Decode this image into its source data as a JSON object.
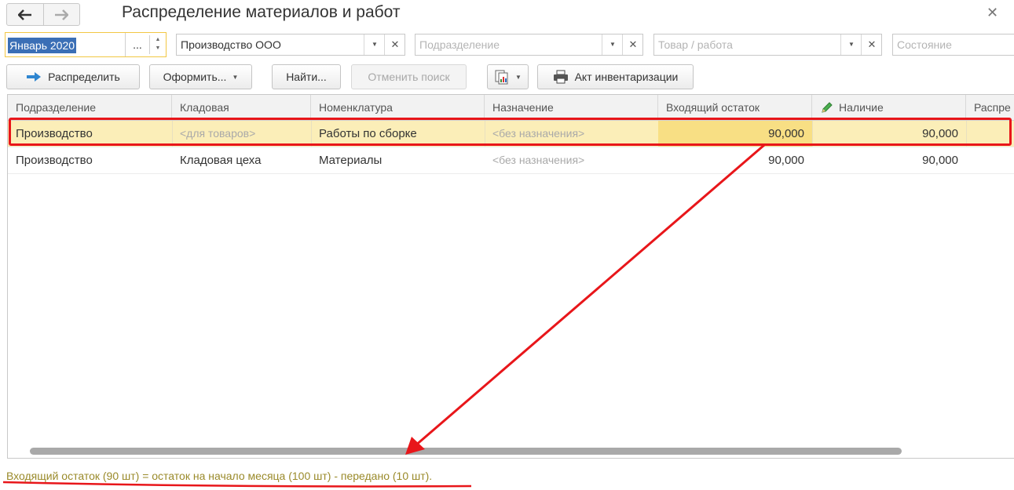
{
  "window": {
    "title": "Распределение материалов и работ"
  },
  "filters": {
    "period": "Январь 2020",
    "period_dots": "...",
    "organization": "Производство ООО",
    "division_placeholder": "Подразделение",
    "product_placeholder": "Товар / работа",
    "state_placeholder": "Состояние"
  },
  "toolbar": {
    "distribute": "Распределить",
    "issue": "Оформить...",
    "find": "Найти...",
    "cancel_search": "Отменить поиск",
    "inventory_act": "Акт инвентаризации"
  },
  "table": {
    "columns": [
      "Подразделение",
      "Кладовая",
      "Номенклатура",
      "Назначение",
      "Входящий остаток",
      "Наличие",
      "Распре"
    ],
    "rows": [
      {
        "division": "Производство",
        "warehouse": "<для товаров>",
        "item": "Работы по сборке",
        "purpose": "<без назначения>",
        "incoming": "90,000",
        "available": "90,000",
        "selected": true
      },
      {
        "division": "Производство",
        "warehouse": "Кладовая цеха",
        "item": "Материалы",
        "purpose": "<без назначения>",
        "incoming": "90,000",
        "available": "90,000",
        "selected": false
      }
    ]
  },
  "annotation": {
    "note": "Входящий остаток (90 шт) = остаток на начало месяца (100 шт) - передано (10 шт).",
    "color": "#e8161a"
  },
  "colors": {
    "selection": "#fbeeb8",
    "focus": "#f8df84",
    "period_border": "#f2c744"
  }
}
